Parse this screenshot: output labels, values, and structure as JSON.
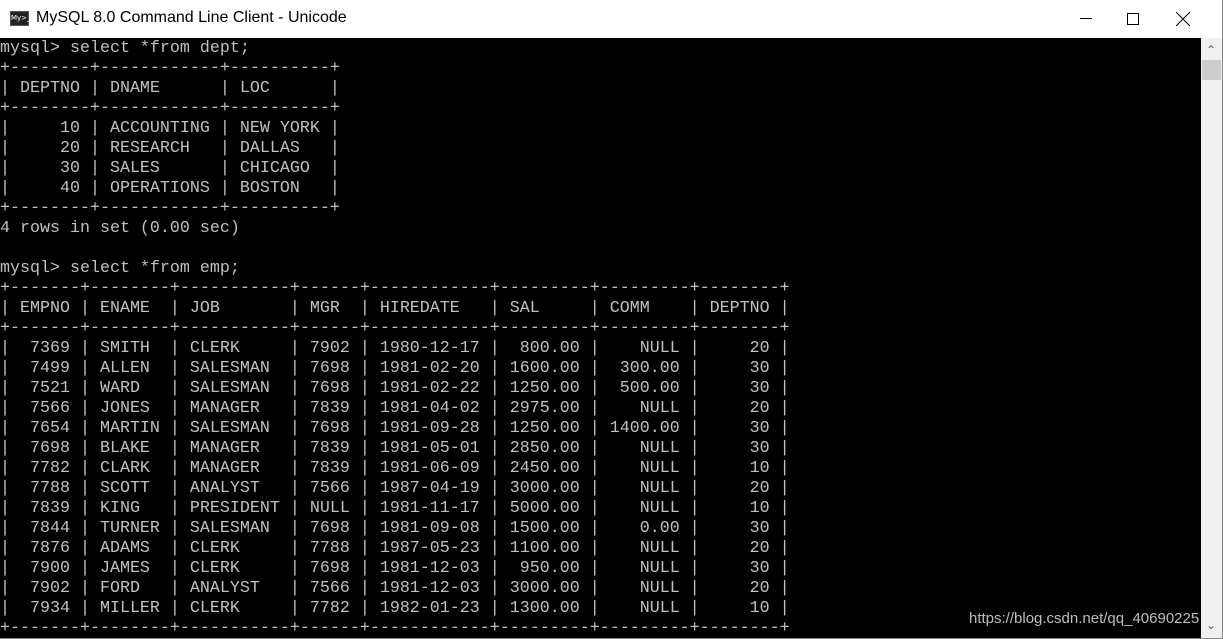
{
  "window": {
    "title": "MySQL 8.0 Command Line Client - Unicode",
    "icon": "mysql-console-icon",
    "icon_text": "My>_"
  },
  "console": {
    "prompt": "mysql> ",
    "queries": [
      {
        "command": "select *from dept;",
        "columns": [
          {
            "name": "DEPTNO",
            "width": 8,
            "align": "right"
          },
          {
            "name": "DNAME",
            "width": 12,
            "align": "left"
          },
          {
            "name": "LOC",
            "width": 10,
            "align": "left"
          }
        ],
        "rows": [
          [
            "10",
            "ACCOUNTING",
            "NEW YORK"
          ],
          [
            "20",
            "RESEARCH",
            "DALLAS"
          ],
          [
            "30",
            "SALES",
            "CHICAGO"
          ],
          [
            "40",
            "OPERATIONS",
            "BOSTON"
          ]
        ],
        "status": "4 rows in set (0.00 sec)"
      },
      {
        "command": "select *from emp;",
        "columns": [
          {
            "name": "EMPNO",
            "width": 7,
            "align": "right"
          },
          {
            "name": "ENAME",
            "width": 8,
            "align": "left"
          },
          {
            "name": "JOB",
            "width": 11,
            "align": "left"
          },
          {
            "name": "MGR",
            "width": 6,
            "align": "left"
          },
          {
            "name": "HIREDATE",
            "width": 12,
            "align": "left"
          },
          {
            "name": "SAL",
            "width": 9,
            "align": "right"
          },
          {
            "name": "COMM",
            "width": 9,
            "align": "right"
          },
          {
            "name": "DEPTNO",
            "width": 8,
            "align": "right"
          }
        ],
        "rows": [
          [
            "7369",
            "SMITH",
            "CLERK",
            "7902",
            "1980-12-17",
            "800.00",
            "NULL",
            "20"
          ],
          [
            "7499",
            "ALLEN",
            "SALESMAN",
            "7698",
            "1981-02-20",
            "1600.00",
            "300.00",
            "30"
          ],
          [
            "7521",
            "WARD",
            "SALESMAN",
            "7698",
            "1981-02-22",
            "1250.00",
            "500.00",
            "30"
          ],
          [
            "7566",
            "JONES",
            "MANAGER",
            "7839",
            "1981-04-02",
            "2975.00",
            "NULL",
            "20"
          ],
          [
            "7654",
            "MARTIN",
            "SALESMAN",
            "7698",
            "1981-09-28",
            "1250.00",
            "1400.00",
            "30"
          ],
          [
            "7698",
            "BLAKE",
            "MANAGER",
            "7839",
            "1981-05-01",
            "2850.00",
            "NULL",
            "30"
          ],
          [
            "7782",
            "CLARK",
            "MANAGER",
            "7839",
            "1981-06-09",
            "2450.00",
            "NULL",
            "10"
          ],
          [
            "7788",
            "SCOTT",
            "ANALYST",
            "7566",
            "1987-04-19",
            "3000.00",
            "NULL",
            "20"
          ],
          [
            "7839",
            "KING",
            "PRESIDENT",
            "NULL",
            "1981-11-17",
            "5000.00",
            "NULL",
            "10"
          ],
          [
            "7844",
            "TURNER",
            "SALESMAN",
            "7698",
            "1981-09-08",
            "1500.00",
            "0.00",
            "30"
          ],
          [
            "7876",
            "ADAMS",
            "CLERK",
            "7788",
            "1987-05-23",
            "1100.00",
            "NULL",
            "20"
          ],
          [
            "7900",
            "JAMES",
            "CLERK",
            "7698",
            "1981-12-03",
            "950.00",
            "NULL",
            "30"
          ],
          [
            "7902",
            "FORD",
            "ANALYST",
            "7566",
            "1981-12-03",
            "3000.00",
            "NULL",
            "20"
          ],
          [
            "7934",
            "MILLER",
            "CLERK",
            "7782",
            "1982-01-23",
            "1300.00",
            "NULL",
            "10"
          ]
        ],
        "status": ""
      }
    ]
  },
  "watermark": "https://blog.csdn.net/qq_40690225",
  "colors": {
    "console_bg": "#000000",
    "console_text": "#c0c0c0"
  }
}
